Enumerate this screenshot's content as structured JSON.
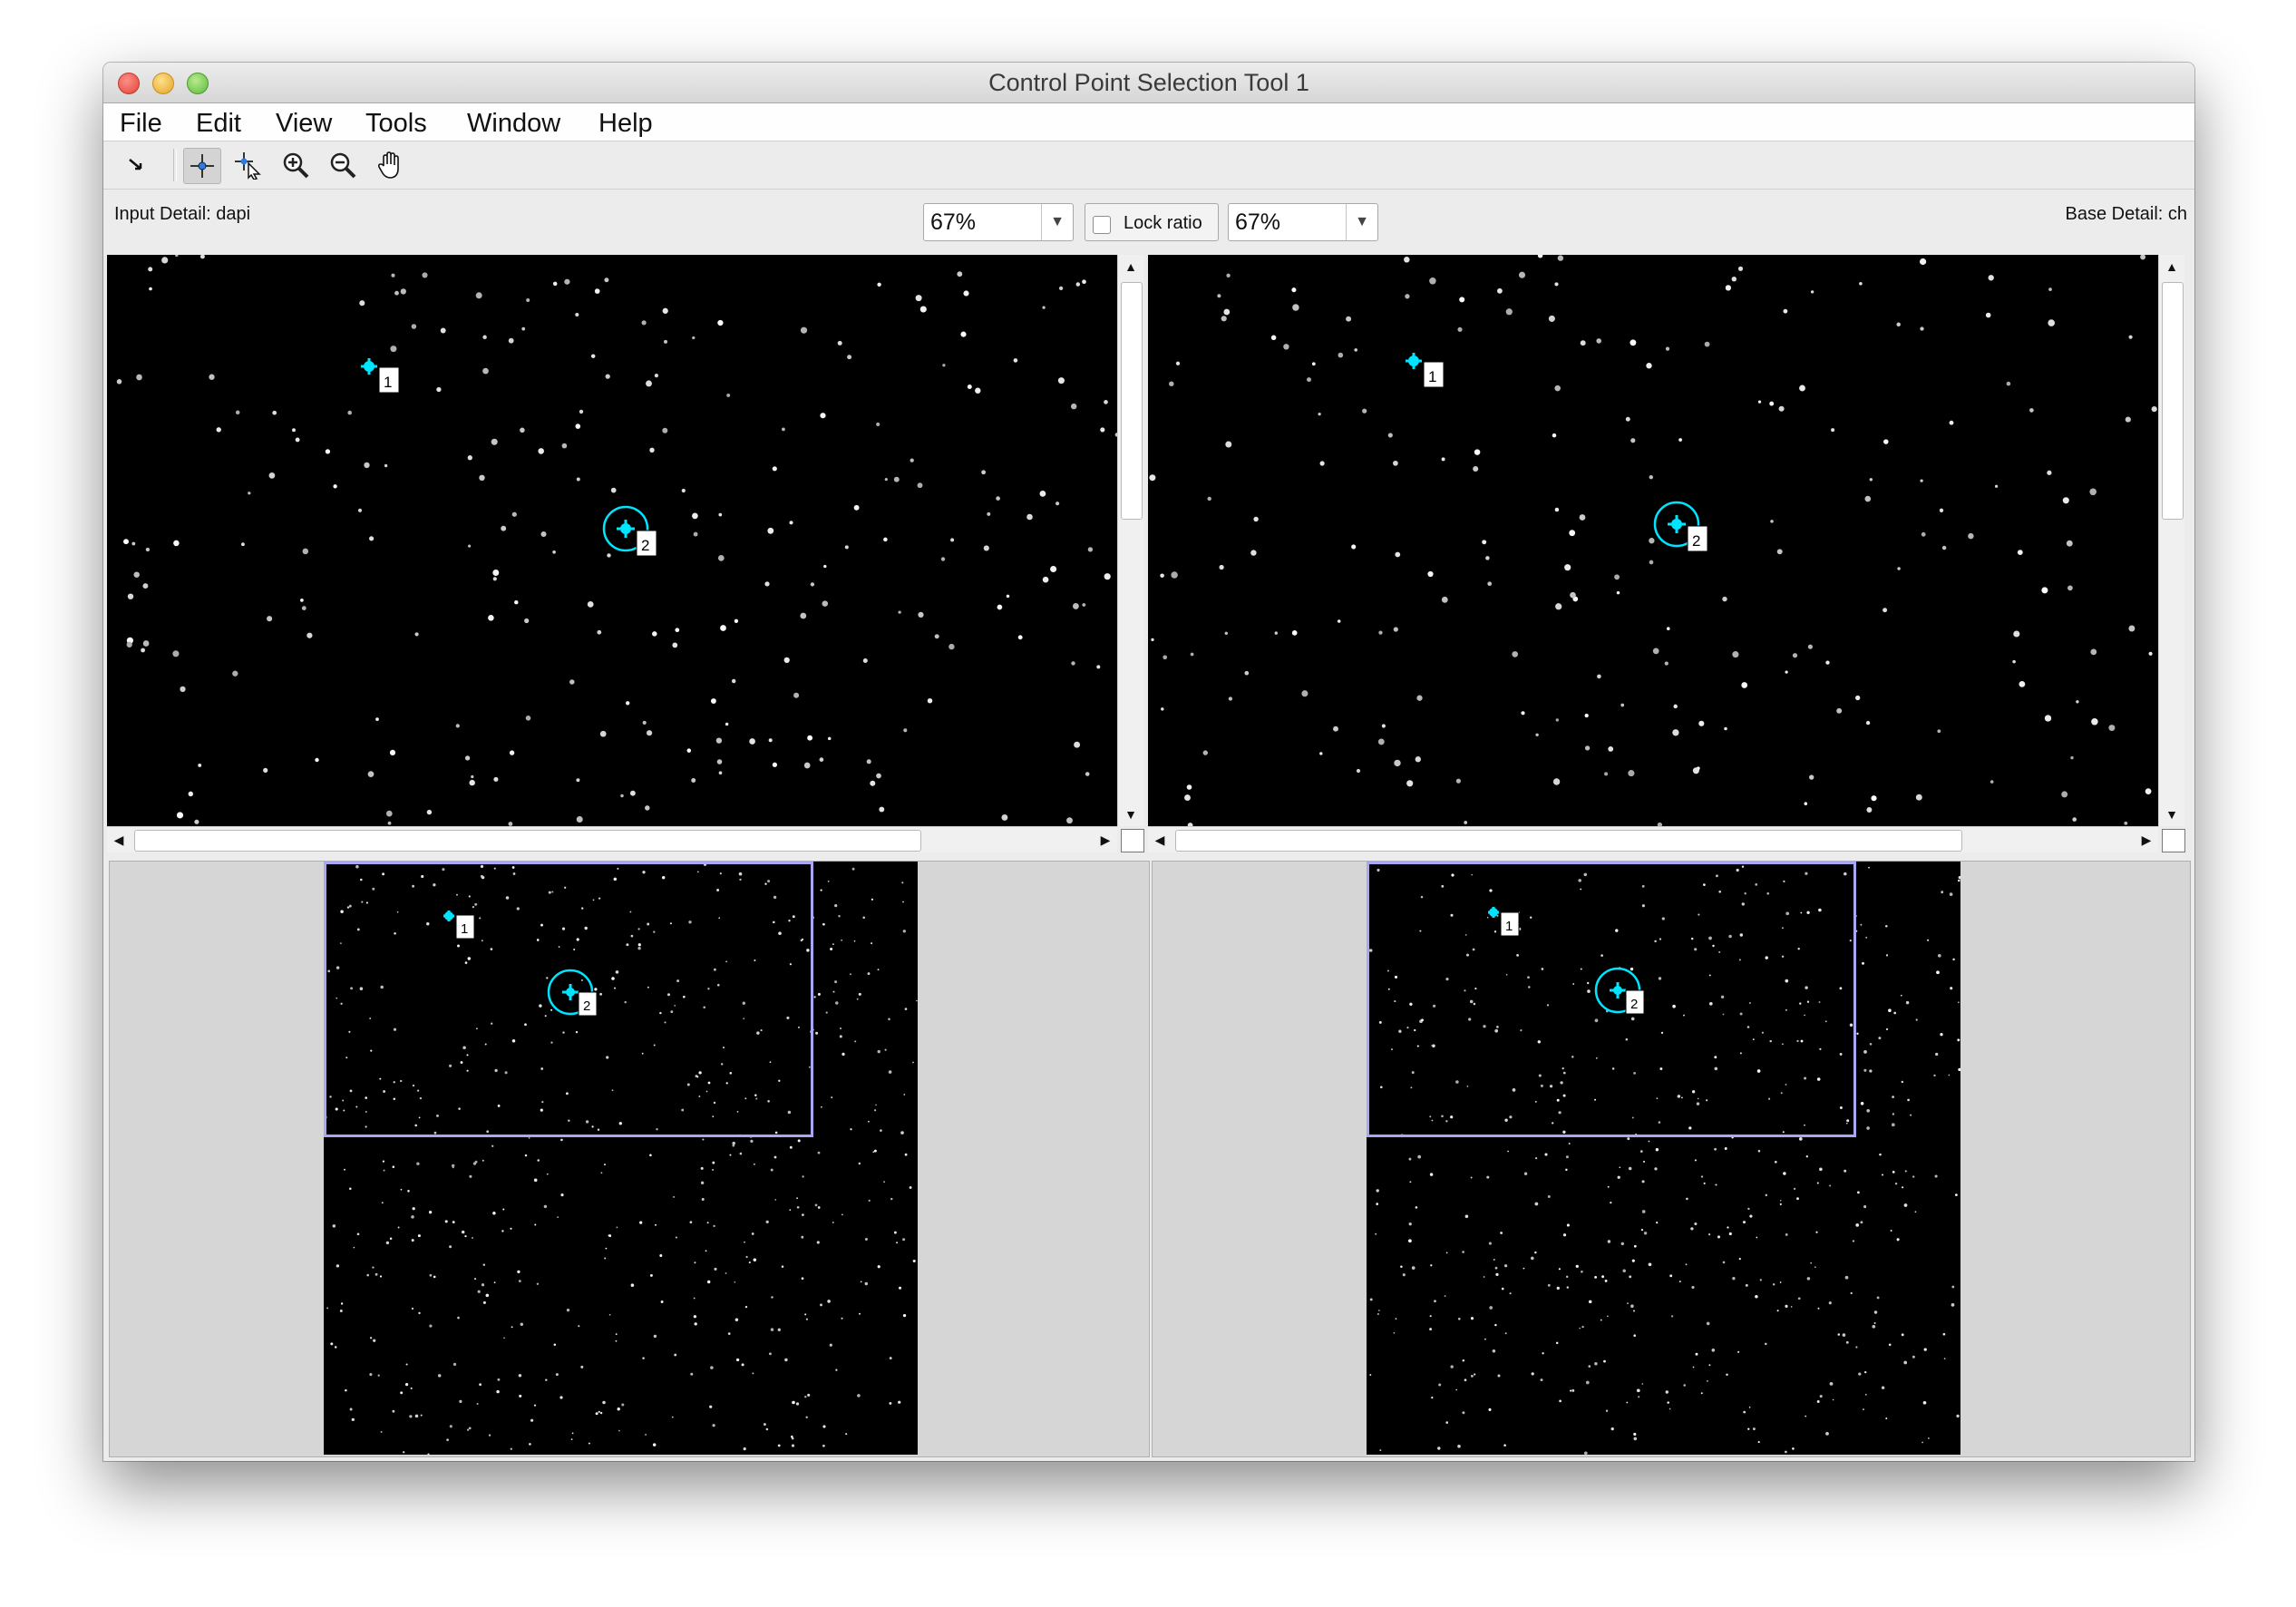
{
  "window": {
    "title": "Control Point Selection Tool 1"
  },
  "menu": [
    "File",
    "Edit",
    "View",
    "Tools",
    "Window",
    "Help"
  ],
  "toolbar": {
    "tools": [
      {
        "name": "arrow-tool-icon",
        "active": false
      },
      {
        "name": "add-point-icon",
        "active": true
      },
      {
        "name": "select-point-icon",
        "active": false
      },
      {
        "name": "zoom-in-icon",
        "active": false
      },
      {
        "name": "zoom-out-icon",
        "active": false
      },
      {
        "name": "pan-hand-icon",
        "active": false
      }
    ]
  },
  "controls": {
    "input_detail": "Input Detail: dapi",
    "base_detail": "Base Detail: ch",
    "input_zoom": "67%",
    "base_zoom": "67%",
    "lock_ratio_label": "Lock ratio",
    "lock_ratio_checked": false
  },
  "control_points": [
    {
      "label": "1"
    },
    {
      "label": "2"
    }
  ],
  "colors": {
    "control_point": "#00e5ff",
    "view_rectangle": "#a9a6f3",
    "image_background": "#000000"
  }
}
